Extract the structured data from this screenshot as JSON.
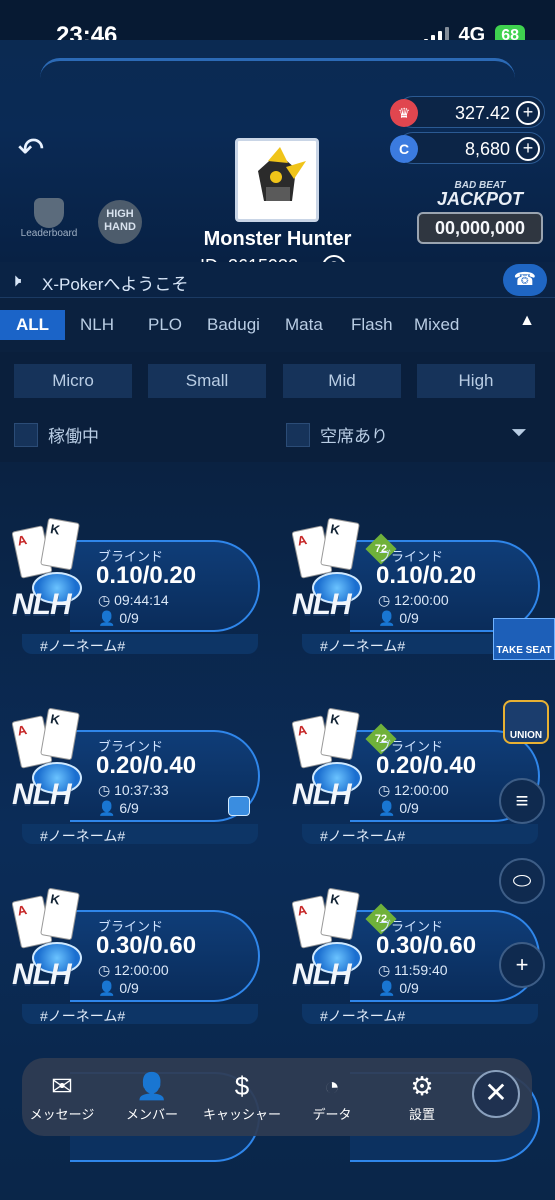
{
  "status_bar": {
    "time": "23:46",
    "network": "4G",
    "battery": "68"
  },
  "header": {
    "player_name": "Monster Hunter",
    "player_id": "ID: 2615932",
    "balance_red": "327.42",
    "balance_blue": "8,680",
    "leaderboard_label": "Leaderboard",
    "high_hand_label": "HIGH HAND",
    "jackpot_top": "BAD BEAT",
    "jackpot_word": "JACKPOT",
    "jackpot_value": "00,000,000"
  },
  "announcement": {
    "text": "X-Pokerへようこそ"
  },
  "tabs": [
    {
      "label": "ALL"
    },
    {
      "label": "NLH"
    },
    {
      "label": "PLO"
    },
    {
      "label": "Badugi"
    },
    {
      "label": "Mata"
    },
    {
      "label": "Flash"
    },
    {
      "label": "Mixed"
    }
  ],
  "stakes": [
    "Micro",
    "Small",
    "Mid",
    "High"
  ],
  "filters": {
    "active": "稼働中",
    "open_seats": "空席あり"
  },
  "tables": [
    {
      "blind_label": "ブラインド",
      "stakes": "0.10/0.20",
      "time": "09:44:14",
      "players": "0/9",
      "game": "NLH",
      "name": "#ノーネーム#"
    },
    {
      "blind_label": "ブラインド",
      "stakes": "0.10/0.20",
      "time": "12:00:00",
      "players": "0/9",
      "game": "NLH",
      "name": "#ノーネーム#"
    },
    {
      "blind_label": "ブラインド",
      "stakes": "0.20/0.40",
      "time": "10:37:33",
      "players": "6/9",
      "game": "NLH",
      "name": "#ノーネーム#"
    },
    {
      "blind_label": "ブラインド",
      "stakes": "0.20/0.40",
      "time": "12:00:00",
      "players": "0/9",
      "game": "NLH",
      "name": "#ノーネーム#"
    },
    {
      "blind_label": "ブラインド",
      "stakes": "0.30/0.60",
      "time": "12:00:00",
      "players": "0/9",
      "game": "NLH",
      "name": "#ノーネーム#"
    },
    {
      "blind_label": "ブラインド",
      "stakes": "0.30/0.60",
      "time": "11:59:40",
      "players": "0/9",
      "game": "NLH",
      "name": "#ノーネーム#"
    }
  ],
  "side_buttons": {
    "take_seat": "TAKE SEAT",
    "union": "UNION"
  },
  "dock": {
    "items": [
      {
        "label": "メッセージ",
        "icon": "mail-icon"
      },
      {
        "label": "メンバー",
        "icon": "person-icon"
      },
      {
        "label": "キャッシャー",
        "icon": "dollar-icon"
      },
      {
        "label": "データ",
        "icon": "pie-chart-icon"
      },
      {
        "label": "設置",
        "icon": "gear-icon"
      }
    ]
  },
  "colors": {
    "accent": "#1b64c8",
    "background": "#071a33"
  }
}
